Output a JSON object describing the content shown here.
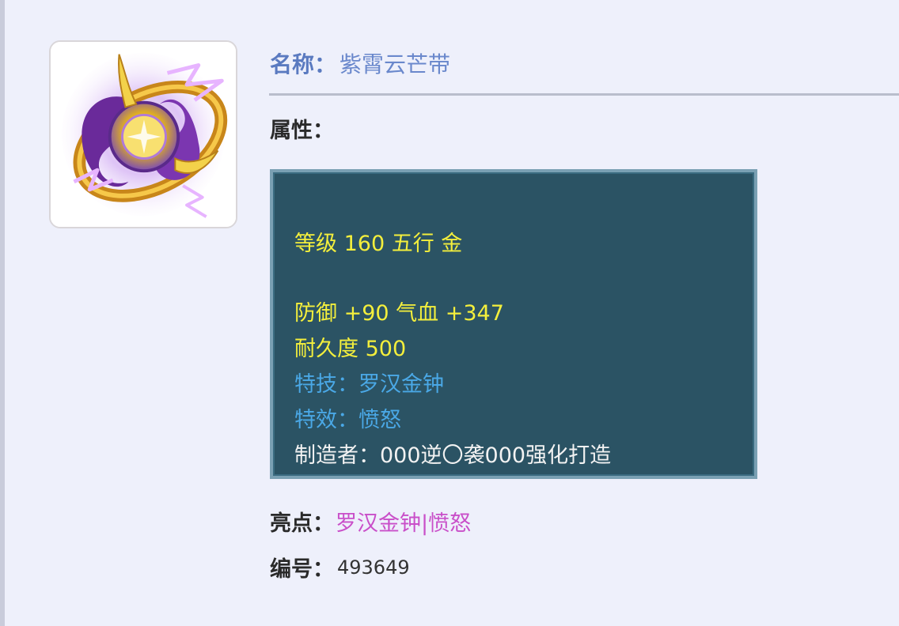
{
  "item": {
    "name_label": "名称：",
    "name_value": "紫霄云芒带",
    "attributes_label": "属性："
  },
  "stats": {
    "level_line": "等级 160 五行 金",
    "defense_line": "防御 +90 气血 +347",
    "durability_line": "耐久度 500",
    "skill_line": "特技：罗汉金钟",
    "effect_line": "特效：愤怒",
    "maker_line": "制造者：000逆〇袭000强化打造"
  },
  "highlights": {
    "label": "亮点：",
    "value": "罗汉金钟|愤怒"
  },
  "serial": {
    "label": "编号：",
    "value": "493649"
  },
  "colors": {
    "background": "#eef0fb",
    "panel": "#2b5364",
    "stat_yellow": "#f4ef3c",
    "stat_blue": "#4aa8e6",
    "highlight_pink": "#c94fc9",
    "name_blue": "#6a88cc"
  },
  "icons": {
    "item_icon": "belt-equipment-icon"
  }
}
